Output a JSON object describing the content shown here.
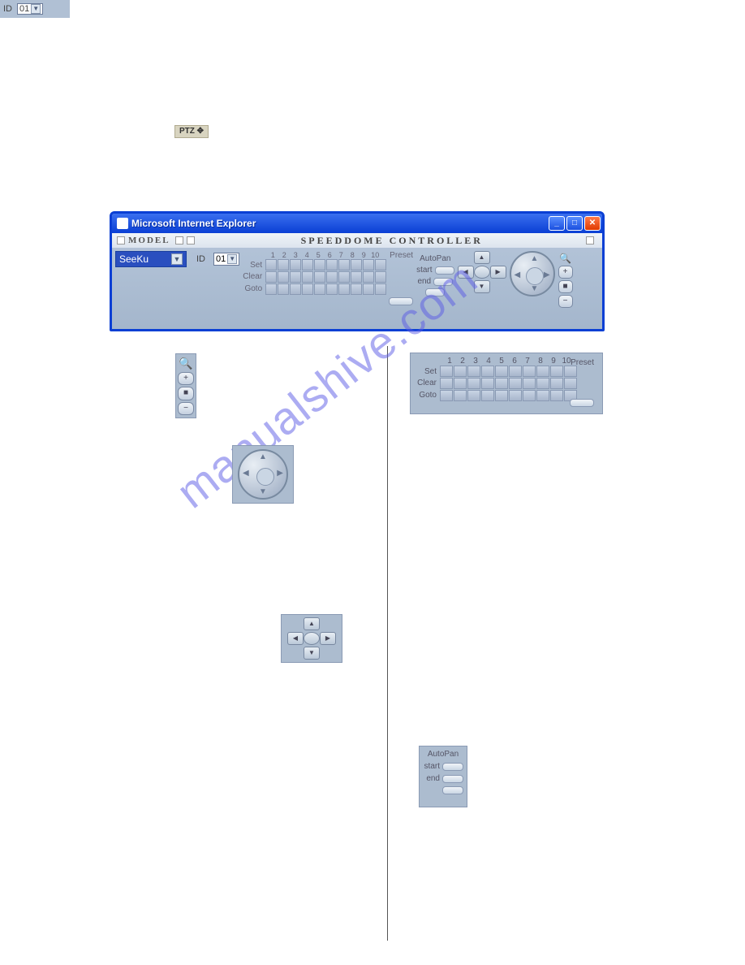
{
  "ptz_badge": "PTZ ✥",
  "window": {
    "title": "Microsoft Internet Explorer",
    "model_label": "MODEL",
    "header_title": "SPEEDDOME CONTROLLER",
    "model_value": "SeeKu",
    "id_label": "ID",
    "id_value": "01"
  },
  "preset": {
    "nums": [
      "1",
      "2",
      "3",
      "4",
      "5",
      "6",
      "7",
      "8",
      "9",
      "10"
    ],
    "rows": [
      "Set",
      "Clear",
      "Goto"
    ],
    "title": "Preset"
  },
  "autopan": {
    "title": "AutoPan",
    "start": "start",
    "end": "end"
  },
  "zoom": {
    "plus": "+",
    "mid": "■",
    "minus": "−"
  },
  "dpad": {
    "up": "▲",
    "down": "▼",
    "left": "◀",
    "right": "▶",
    "center": ""
  },
  "id_detail": {
    "label": "ID",
    "value": "01"
  },
  "watermark": "manualshive.com"
}
